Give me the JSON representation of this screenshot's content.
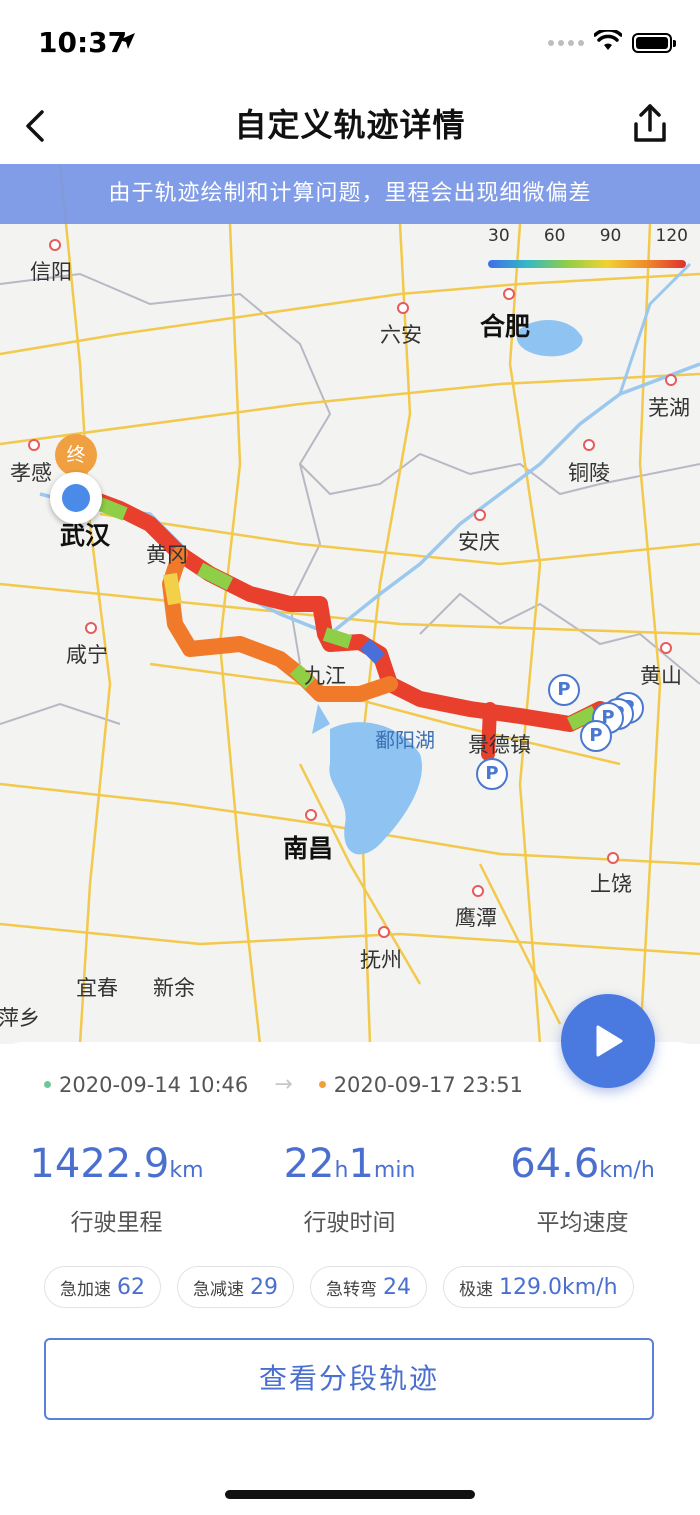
{
  "status_bar": {
    "time": "10:37"
  },
  "nav": {
    "title": "自定义轨迹详情"
  },
  "map": {
    "notice": "由于轨迹绘制和计算问题，里程会出现细微偏差",
    "legend": [
      "30",
      "60",
      "90",
      "120"
    ],
    "cities": {
      "xinyang": "信阳",
      "luan": "六安",
      "hefei": "合肥",
      "wuhu": "芜湖",
      "xiaogan": "孝感",
      "tongling": "铜陵",
      "wuhan": "武汉",
      "huanggang": "黄冈",
      "anqing": "安庆",
      "xianning": "咸宁",
      "huangshan": "黄山",
      "jiujiang": "九江",
      "poyang_lake": "鄱阳湖",
      "jingdezhen": "景德镇",
      "nanchang": "南昌",
      "shangrao": "上饶",
      "yingtan": "鹰潭",
      "fuzhou": "抚州",
      "yichun": "宜春",
      "xinyu": "新余",
      "pingxiang": "萍乡"
    },
    "end_marker": "终",
    "parking_label": "P",
    "colors": {
      "route_fast": "#e0302e",
      "route_mid": "#f08a2a",
      "route_slow": "#8fce47",
      "route_very_slow": "#4a6fd8"
    }
  },
  "trip": {
    "start_time": "2020-09-14 10:46",
    "end_time": "2020-09-17 23:51",
    "arrow": "→",
    "distance": {
      "value": "1422.9",
      "unit": "km",
      "label": "行驶里程"
    },
    "duration": {
      "hours": "22",
      "hours_unit": "h",
      "minutes": "1",
      "minutes_unit": "min",
      "label": "行驶时间"
    },
    "avg_speed": {
      "value": "64.6",
      "unit": "km/h",
      "label": "平均速度"
    },
    "events": [
      {
        "label": "急加速",
        "value": "62"
      },
      {
        "label": "急减速",
        "value": "29"
      },
      {
        "label": "急转弯",
        "value": "24"
      },
      {
        "label": "极速",
        "value": "129.0km/h"
      }
    ],
    "segment_button": "查看分段轨迹"
  },
  "colors": {
    "accent": "#4a6fcf",
    "start_dot": "#6cc79a",
    "end_dot": "#f0a040"
  }
}
